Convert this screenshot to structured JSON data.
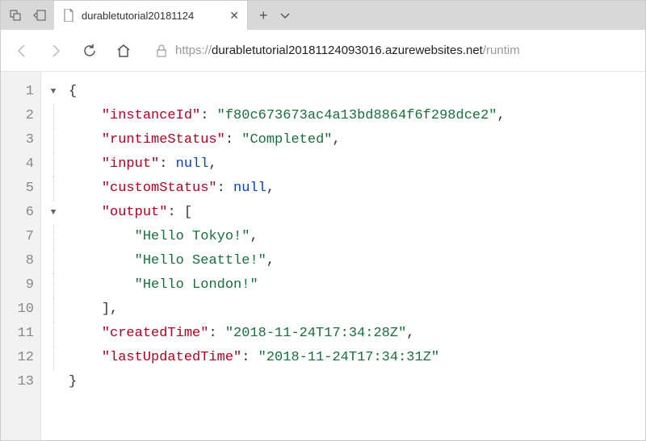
{
  "browser": {
    "tab_title": "durabletutorial20181124",
    "url_scheme": "https://",
    "url_host": "durabletutorial20181124093016.azurewebsites.net",
    "url_path": "/runtim"
  },
  "code": {
    "lines": [
      {
        "n": 1,
        "fold": "▼",
        "indent": 0,
        "parts": [
          {
            "cls": "punct",
            "t": "{"
          }
        ]
      },
      {
        "n": 2,
        "fold": "guide",
        "indent": 1,
        "parts": [
          {
            "cls": "key",
            "t": "\"instanceId\""
          },
          {
            "cls": "punct",
            "t": ": "
          },
          {
            "cls": "str",
            "t": "\"f80c673673ac4a13bd8864f6f298dce2\""
          },
          {
            "cls": "punct",
            "t": ","
          }
        ]
      },
      {
        "n": 3,
        "fold": "guide",
        "indent": 1,
        "parts": [
          {
            "cls": "key",
            "t": "\"runtimeStatus\""
          },
          {
            "cls": "punct",
            "t": ": "
          },
          {
            "cls": "str",
            "t": "\"Completed\""
          },
          {
            "cls": "punct",
            "t": ","
          }
        ]
      },
      {
        "n": 4,
        "fold": "guide",
        "indent": 1,
        "parts": [
          {
            "cls": "key",
            "t": "\"input\""
          },
          {
            "cls": "punct",
            "t": ": "
          },
          {
            "cls": "kw",
            "t": "null"
          },
          {
            "cls": "punct",
            "t": ","
          }
        ]
      },
      {
        "n": 5,
        "fold": "guide",
        "indent": 1,
        "parts": [
          {
            "cls": "key",
            "t": "\"customStatus\""
          },
          {
            "cls": "punct",
            "t": ": "
          },
          {
            "cls": "kw",
            "t": "null"
          },
          {
            "cls": "punct",
            "t": ","
          }
        ]
      },
      {
        "n": 6,
        "fold": "▼",
        "indent": 1,
        "parts": [
          {
            "cls": "key",
            "t": "\"output\""
          },
          {
            "cls": "punct",
            "t": ": ["
          }
        ]
      },
      {
        "n": 7,
        "fold": "guide",
        "indent": 2,
        "parts": [
          {
            "cls": "str",
            "t": "\"Hello Tokyo!\""
          },
          {
            "cls": "punct",
            "t": ","
          }
        ]
      },
      {
        "n": 8,
        "fold": "guide",
        "indent": 2,
        "parts": [
          {
            "cls": "str",
            "t": "\"Hello Seattle!\""
          },
          {
            "cls": "punct",
            "t": ","
          }
        ]
      },
      {
        "n": 9,
        "fold": "guide",
        "indent": 2,
        "parts": [
          {
            "cls": "str",
            "t": "\"Hello London!\""
          }
        ]
      },
      {
        "n": 10,
        "fold": "guide",
        "indent": 1,
        "parts": [
          {
            "cls": "punct",
            "t": "],"
          }
        ]
      },
      {
        "n": 11,
        "fold": "guide",
        "indent": 1,
        "parts": [
          {
            "cls": "key",
            "t": "\"createdTime\""
          },
          {
            "cls": "punct",
            "t": ": "
          },
          {
            "cls": "str",
            "t": "\"2018-11-24T17:34:28Z\""
          },
          {
            "cls": "punct",
            "t": ","
          }
        ]
      },
      {
        "n": 12,
        "fold": "guide",
        "indent": 1,
        "parts": [
          {
            "cls": "key",
            "t": "\"lastUpdatedTime\""
          },
          {
            "cls": "punct",
            "t": ": "
          },
          {
            "cls": "str",
            "t": "\"2018-11-24T17:34:31Z\""
          }
        ]
      },
      {
        "n": 13,
        "fold": "",
        "indent": 0,
        "parts": [
          {
            "cls": "punct",
            "t": "}"
          }
        ]
      }
    ]
  }
}
